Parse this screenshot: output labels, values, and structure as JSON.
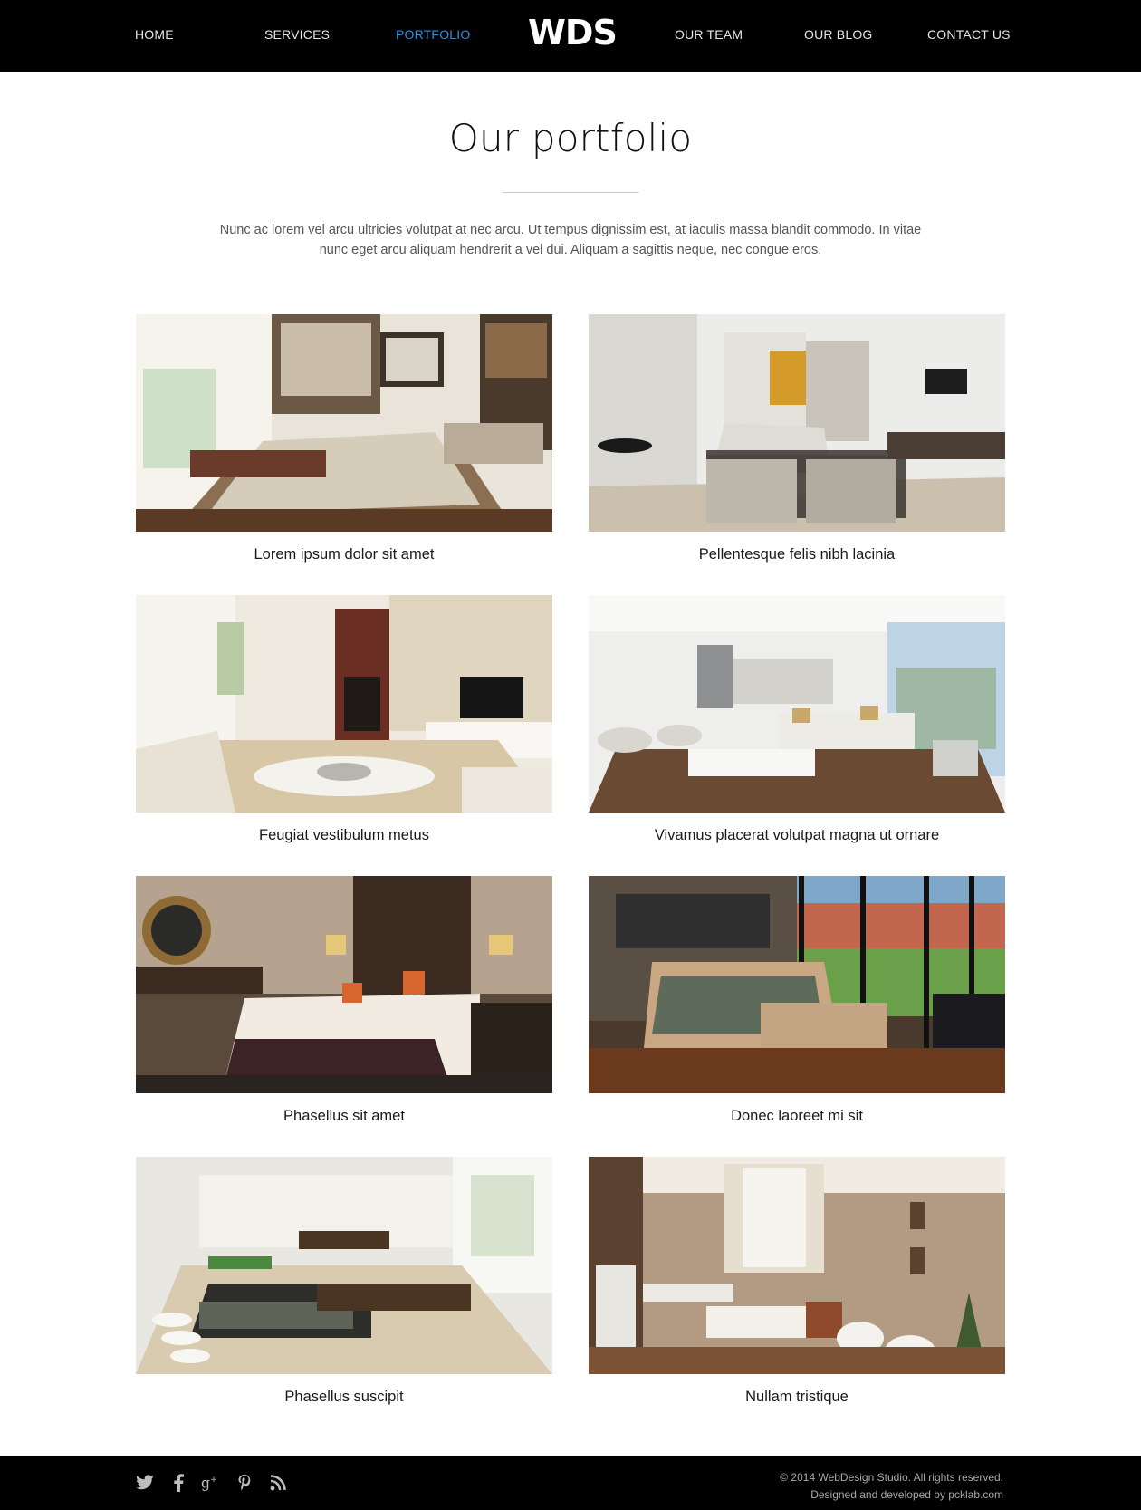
{
  "header": {
    "logo": "WDS",
    "nav": [
      {
        "label": "HOME",
        "active": false
      },
      {
        "label": "SERVICES",
        "active": false
      },
      {
        "label": "PORTFOLIO",
        "active": true
      },
      {
        "label": "OUR TEAM",
        "active": false
      },
      {
        "label": "OUR BLOG",
        "active": false
      },
      {
        "label": "CONTACT US",
        "active": false
      }
    ],
    "accent_color": "#2e8fd6"
  },
  "intro": {
    "title": "Our portfolio",
    "text": "Nunc ac lorem vel arcu ultricies volutpat at nec arcu. Ut tempus dignissim est, at iaculis massa blandit commodo. In vitae nunc eget arcu aliquam hendrerit a vel dui. Aliquam a sagittis neque, nec congue eros."
  },
  "portfolio": [
    {
      "caption": "Lorem ipsum dolor sit amet",
      "image": "bedroom-sunlit-photo"
    },
    {
      "caption": "Pellentesque felis nibh lacinia",
      "image": "living-room-modern-photo"
    },
    {
      "caption": "Feugiat vestibulum metus",
      "image": "living-room-fireplace-photo"
    },
    {
      "caption": "Vivamus placerat volutpat magna ut ornare",
      "image": "open-plan-kitchen-lounge-photo"
    },
    {
      "caption": "Phasellus sit amet",
      "image": "bedroom-dark-wood-photo"
    },
    {
      "caption": "Donec laoreet mi sit",
      "image": "bedroom-garden-view-photo"
    },
    {
      "caption": "Phasellus suscipit",
      "image": "bathroom-pool-photo"
    },
    {
      "caption": "Nullam tristique",
      "image": "bathroom-beige-tiles-photo"
    }
  ],
  "footer": {
    "social": [
      "twitter-icon",
      "facebook-icon",
      "google-plus-icon",
      "pinterest-icon",
      "rss-icon"
    ],
    "copyright": "© 2014 WebDesign Studio. All rights reserved.",
    "credit": "Designed and developed by pcklab.com"
  }
}
